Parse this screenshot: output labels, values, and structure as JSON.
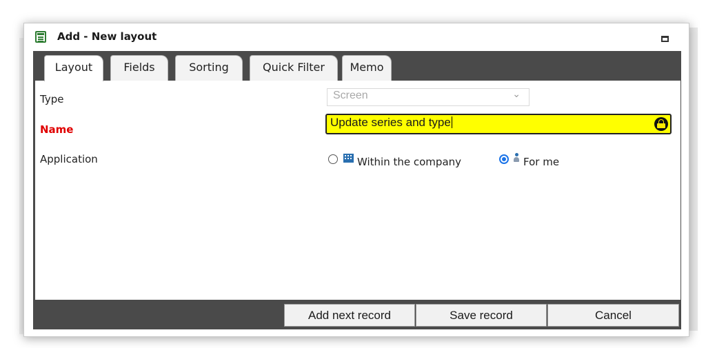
{
  "dialog": {
    "title": "Add - New layout",
    "icon": "layout-list-icon"
  },
  "tabs": [
    {
      "label": "Layout",
      "active": true
    },
    {
      "label": "Fields",
      "active": false
    },
    {
      "label": "Sorting",
      "active": false
    },
    {
      "label": "Quick Filter",
      "active": false
    },
    {
      "label": "Memo",
      "active": false
    }
  ],
  "form": {
    "type_label": "Type",
    "type_value": "Screen",
    "name_label": "Name",
    "name_value": "Update series and type",
    "application_label": "Application",
    "application_options": [
      {
        "label": "Within the company",
        "icon": "building-icon",
        "selected": false
      },
      {
        "label": "For me",
        "icon": "person-icon",
        "selected": true
      }
    ]
  },
  "buttons": {
    "add_next": "Add next record",
    "save": "Save record",
    "cancel": "Cancel"
  },
  "colors": {
    "required_label": "#e00000",
    "name_field_highlight": "#ffff00",
    "panel_background": "#4a4a4a",
    "radio_selected": "#1a73e8"
  }
}
